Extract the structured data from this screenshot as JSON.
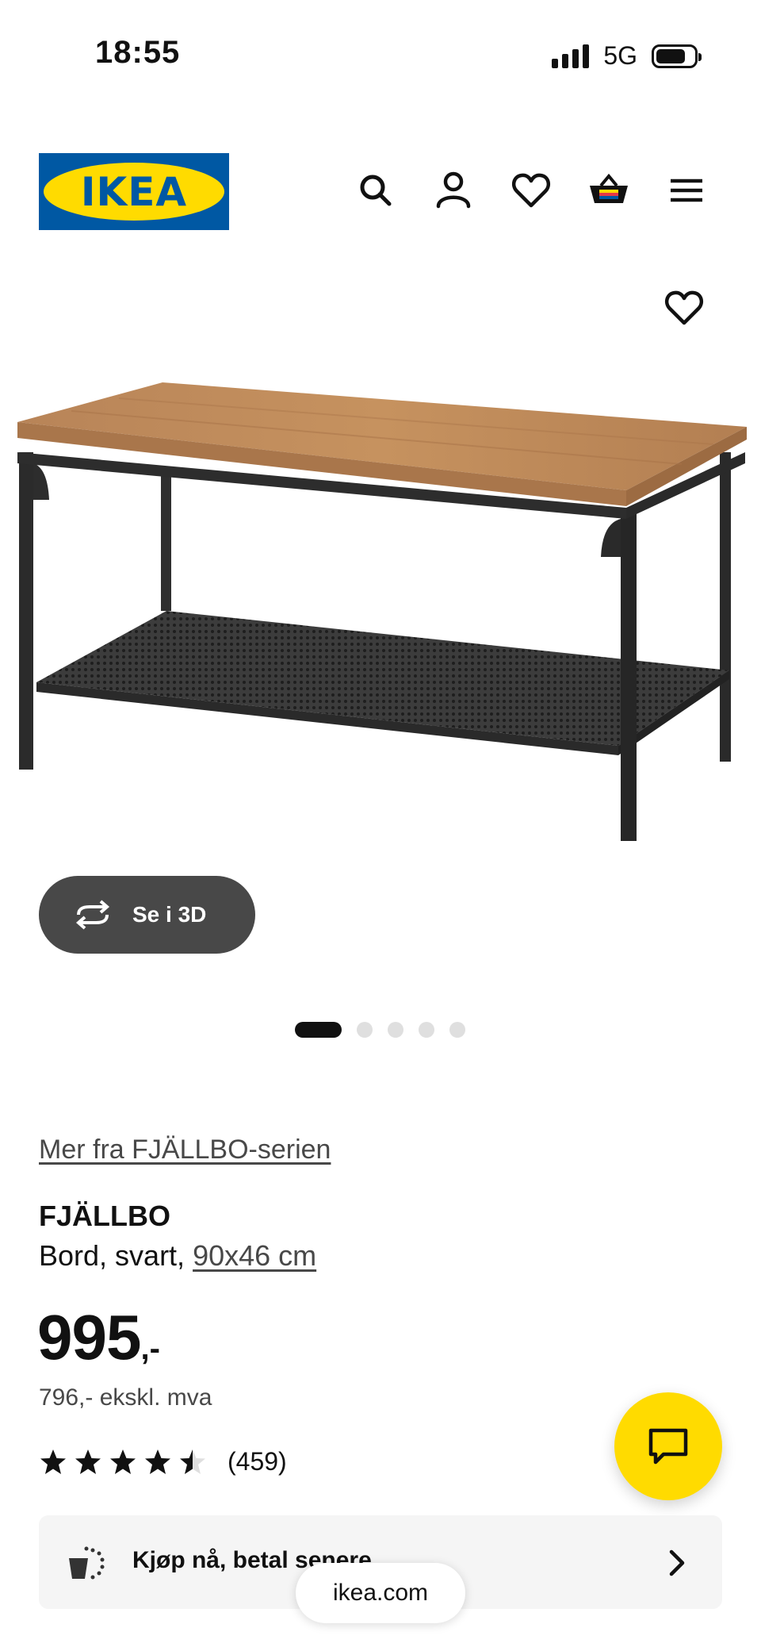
{
  "status_bar": {
    "time": "18:55",
    "network": "5G",
    "battery": 0.8
  },
  "header": {
    "logo_text": "IKEA",
    "icons": [
      "search-icon",
      "account-icon",
      "heart-icon",
      "basket-icon",
      "menu-icon"
    ]
  },
  "gallery": {
    "favorite_icon": "heart-icon",
    "view_3d_label": "Se i 3D",
    "total_images": 5,
    "active_index": 0
  },
  "product": {
    "series_link": "Mer fra FJÄLLBO-serien",
    "name": "FJÄLLBO",
    "description": "Bord, svart, ",
    "size": "90x46 cm",
    "price": "995",
    "price_suffix": ",-",
    "price_ex_vat": "796,- ekskl. mva",
    "rating": 4.5,
    "reviews": "(459)"
  },
  "banner": {
    "label": "Kjøp nå, betal senere"
  },
  "browser": {
    "url": "ikea.com"
  },
  "colors": {
    "brand_blue": "#0058a3",
    "brand_yellow": "#ffdb00",
    "dark_button": "#484848",
    "text": "#111111"
  }
}
